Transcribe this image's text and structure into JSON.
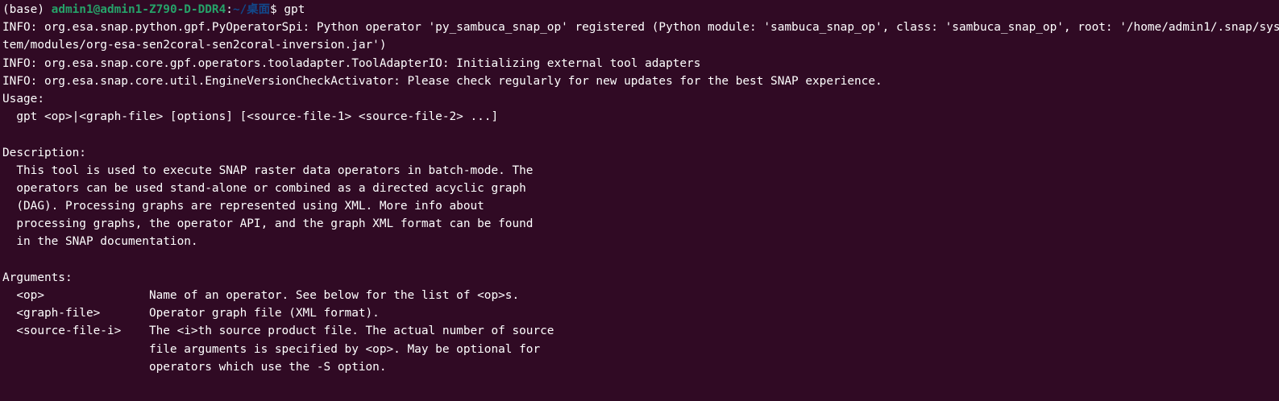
{
  "prompt": {
    "env": "(base) ",
    "user_host": "admin1@admin1-Z790-D-DDR4",
    "separator": ":",
    "cwd": "~/桌面",
    "symbol": "$ ",
    "command": "gpt"
  },
  "colors": {
    "background": "#300a24",
    "text": "#ffffff",
    "user_host": "#26a269",
    "cwd": "#12488b"
  },
  "output_lines": [
    "INFO: org.esa.snap.python.gpf.PyOperatorSpi: Python operator 'py_sambuca_snap_op' registered (Python module: 'sambuca_snap_op', class: 'sambuca_snap_op', root: '/home/admin1/.snap/sys",
    "tem/modules/org-esa-sen2coral-sen2coral-inversion.jar')",
    "INFO: org.esa.snap.core.gpf.operators.tooladapter.ToolAdapterIO: Initializing external tool adapters",
    "INFO: org.esa.snap.core.util.EngineVersionCheckActivator: Please check regularly for new updates for the best SNAP experience.",
    "Usage:",
    "  gpt <op>|<graph-file> [options] [<source-file-1> <source-file-2> ...]",
    "",
    "Description:",
    "  This tool is used to execute SNAP raster data operators in batch-mode. The",
    "  operators can be used stand-alone or combined as a directed acyclic graph",
    "  (DAG). Processing graphs are represented using XML. More info about",
    "  processing graphs, the operator API, and the graph XML format can be found",
    "  in the SNAP documentation.",
    "",
    "Arguments:",
    "  <op>               Name of an operator. See below for the list of <op>s.",
    "  <graph-file>       Operator graph file (XML format).",
    "  <source-file-i>    The <i>th source product file. The actual number of source",
    "                     file arguments is specified by <op>. May be optional for",
    "                     operators which use the -S option."
  ]
}
